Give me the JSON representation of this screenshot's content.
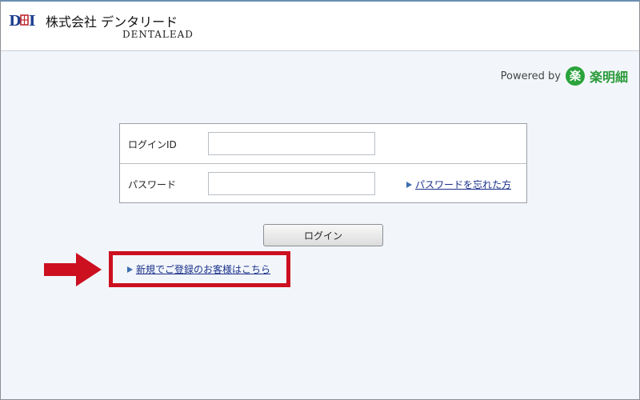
{
  "header": {
    "logo_mark": "DEI",
    "company_name": "株式会社 デンタリード",
    "company_name_en": "DENTALEAD"
  },
  "powered_by": {
    "label": "Powered by",
    "brand_icon": "楽",
    "brand_name": "楽明細",
    "brand_color": "#2a9a39"
  },
  "login_form": {
    "id_label": "ログインID",
    "id_value": "",
    "password_label": "パスワード",
    "password_value": "",
    "forgot_link": "パスワードを忘れた方",
    "submit_label": "ログイン"
  },
  "register_link": "新規でご登録のお客様はこちら",
  "accent_colors": {
    "highlight": "#cc1020",
    "link": "#1a2f8a"
  }
}
